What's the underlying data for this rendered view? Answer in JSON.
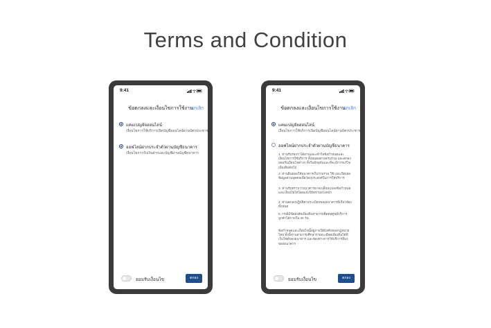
{
  "page_title": "Terms and Condition",
  "phones": [
    {
      "status_time": "9:41",
      "header_title": "ข้อตกลงและเงื่อนไขการใช้งาน",
      "cancel_label": "ยกเลิก",
      "option1_title": "แคมเปญจัยออนไลน์",
      "option1_desc": "เงื่อนไขการใช้บริการเปิดบัญชีออนไลน์ผ่านบัตรประชาชนสมาร์ท",
      "option2_title": "ออฟไลน์ฝากประจำตัวผ่านบัญชีธนาคาร",
      "option2_desc": "เงื่อนไขการรับเงินฝากและบัญชีผ่านบัญชีธนาคาร",
      "accept_label": "ยอมรับเงื่อนไข",
      "ok_label": "ตกลง"
    },
    {
      "status_time": "9:41",
      "header_title": "ข้อตกลงและเงื่อนไขการใช้งาน",
      "cancel_label": "ยกเลิก",
      "option1_title": "แคมเปญจัยออนไลน์",
      "option1_desc": "เงื่อนไขการใช้บริการเปิดบัญชีออนไลน์ผ่านบัตรประชาชนสมาร์ท",
      "option2_title": "ออฟไลน์ฝากประจำตัวผ่านบัญชีธนาคาร",
      "terms": [
        "1. ท่านรับรองว่าได้อ่านและเข้าใจข้อกำหนดและเงื่อนไขการใช้บริการ ทั้งหมดอย่างครบถ้วน และตกลงยอมรับเงื่อนไขต่างๆ ทั้งในปัจจุบันและที่จะมีการแก้ไขเพิ่มเติมต่อไป",
        "2. ท่านยินยอมให้ธนาคารเก็บรวบรวม ใช้ และเปิดเผยข้อมูลส่วนบุคคลเพื่อวัตถุประสงค์ในการให้บริการ",
        "3. ท่านรับทราบว่าธนาคารอาจเปลี่ยนแปลงข้อกำหนดและเงื่อนไขได้โดยแจ้งให้ทราบล่วงหน้า",
        "4. ท่านตกลงปฏิบัติตามระเบียบของธนาคารที่เกี่ยวข้องทั้งหมด",
        "5. กรณีมีข้อสงสัยเพิ่มเติมสามารถติดต่อศูนย์บริการลูกค้าได้ภายใน 30 วัน",
        "ข้อกำหนดและเงื่อนไขนี้อยู่ภายใต้บังคับของกฎหมายไทย ทั้งนี้ท่านสามารถศึกษารายละเอียดเพิ่มเติมได้ที่เว็บไซต์ของธนาคาร และช่องทางการให้บริการอื่นๆ ของธนาคาร"
      ],
      "accept_label": "ยอมรับเงื่อนไข",
      "ok_label": "ตกลง"
    }
  ]
}
